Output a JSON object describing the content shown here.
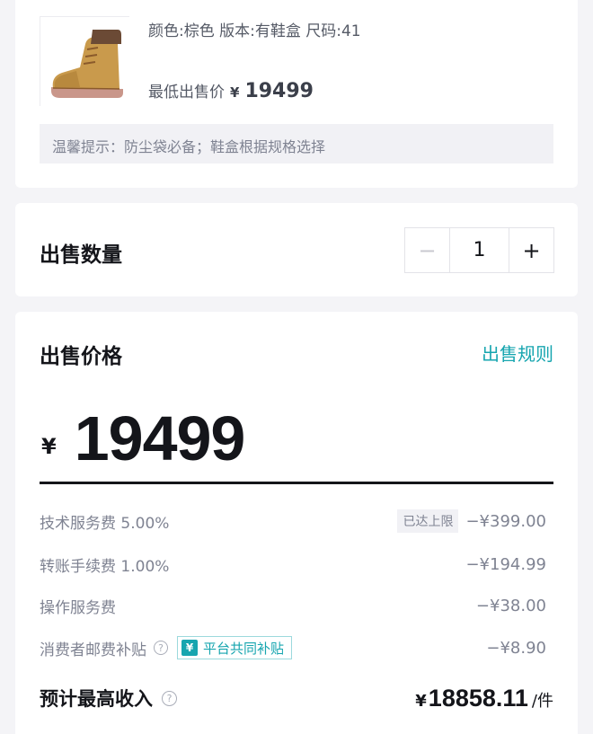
{
  "product": {
    "spec": "颜色:棕色 版本:有鞋盒 尺码:41",
    "lowest_label": "最低出售价",
    "lowest_symbol": "¥",
    "lowest_price": "19499",
    "tip": "温馨提示：防尘袋必备；鞋盒根据规格选择",
    "image_icon": "boot-thumbnail-icon"
  },
  "quantity": {
    "label": "出售数量",
    "minus": "−",
    "value": "1",
    "plus": "+"
  },
  "price": {
    "title": "出售价格",
    "rules_link": "出售规则",
    "currency": "¥",
    "value": "19499"
  },
  "fees": [
    {
      "label": "技术服务费 5.00%",
      "badge": "已达上限",
      "amount": "−¥399.00"
    },
    {
      "label": "转账手续费 1.00%",
      "amount": "−¥194.99"
    },
    {
      "label": "操作服务费",
      "amount": "−¥38.00"
    },
    {
      "label": "消费者邮费补贴",
      "badge_icon": "¥",
      "badge": "平台共同补贴",
      "amount": "−¥8.90"
    }
  ],
  "income": {
    "label": "预计最高收入",
    "currency": "¥",
    "value": "18858.11",
    "unit": "/件"
  },
  "colors": {
    "accent": "#16a5af",
    "text_primary": "#14151a",
    "text_secondary": "#7f8392",
    "background": "#f4f4f7"
  }
}
